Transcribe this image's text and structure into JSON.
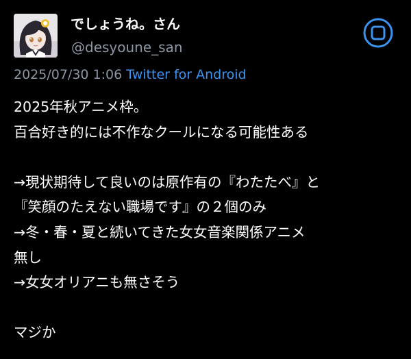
{
  "user": {
    "display_name": "でしょうね。さん",
    "handle": "@desyoune_san"
  },
  "meta": {
    "timestamp": "2025/07/30 1:06",
    "client": "Twitter for Android"
  },
  "body_lines": [
    "2025年秋アニメ枠。",
    "百合好き的には不作なクールになる可能性ある",
    "",
    "→現状期待して良いのは原作有の『わたたべ』と",
    "『笑顔のたえない職場です』の２個のみ",
    "→冬・春・夏と続いてきた女女音楽関係アニメ",
    "無し",
    "→女女オリアニも無さそう",
    "",
    "マジか"
  ],
  "colors": {
    "background": "#000000",
    "text": "#ffffff",
    "muted": "#8b96a3",
    "accent": "#3b93f0"
  },
  "icons": {
    "app_button": "tweet-app-icon"
  }
}
